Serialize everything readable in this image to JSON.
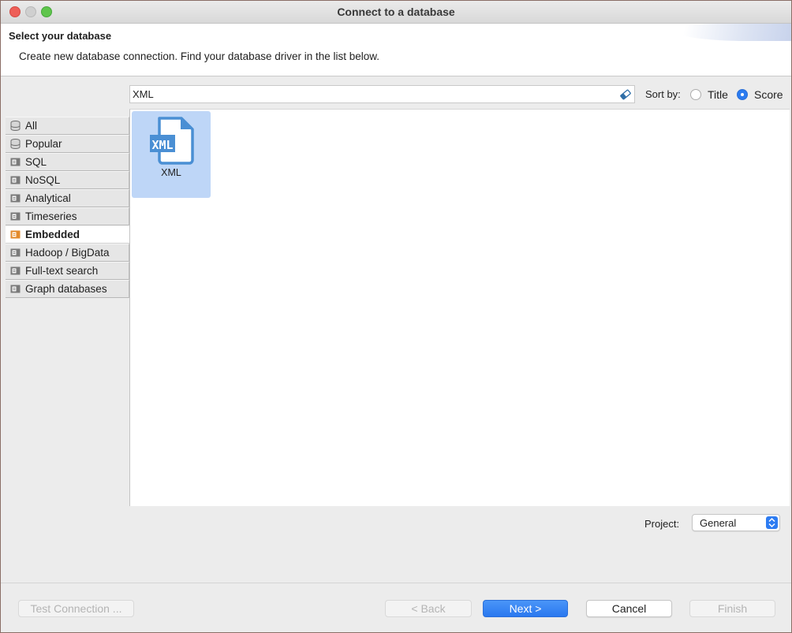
{
  "window": {
    "title": "Connect to a database"
  },
  "header": {
    "title": "Select your database",
    "description": "Create new database connection. Find your database driver in the list below."
  },
  "search": {
    "value": "XML",
    "placeholder": ""
  },
  "sort": {
    "label": "Sort by:",
    "options": [
      "Title",
      "Score"
    ],
    "selected": "Score"
  },
  "categories": [
    {
      "label": "All",
      "icon": "database-icon"
    },
    {
      "label": "Popular",
      "icon": "database-icon"
    },
    {
      "label": "SQL",
      "icon": "folder-icon"
    },
    {
      "label": "NoSQL",
      "icon": "folder-icon"
    },
    {
      "label": "Analytical",
      "icon": "folder-icon"
    },
    {
      "label": "Timeseries",
      "icon": "folder-icon"
    },
    {
      "label": "Embedded",
      "icon": "folder-icon",
      "active": true
    },
    {
      "label": "Hadoop / BigData",
      "icon": "folder-icon"
    },
    {
      "label": "Full-text search",
      "icon": "folder-icon"
    },
    {
      "label": "Graph databases",
      "icon": "folder-icon"
    }
  ],
  "drivers": [
    {
      "label": "XML",
      "icon": "xml-file-icon",
      "selected": true
    }
  ],
  "project": {
    "label": "Project:",
    "value": "General"
  },
  "buttons": {
    "test_connection": "Test Connection ...",
    "back": "< Back",
    "next": "Next >",
    "cancel": "Cancel",
    "finish": "Finish"
  },
  "colors": {
    "accent": "#2b7bf0",
    "tile_selected": "#bed6f7",
    "active_category_icon": "#e38a2a"
  }
}
